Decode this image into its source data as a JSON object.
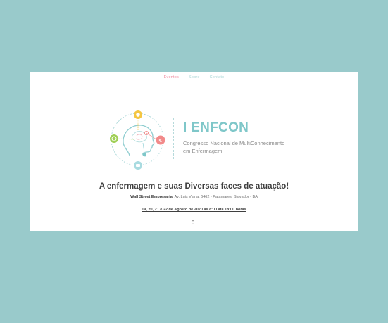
{
  "nav": {
    "items": [
      {
        "label": "Eventos",
        "active": true
      },
      {
        "label": "Sobre",
        "active": false
      },
      {
        "label": "Contato",
        "active": false
      }
    ]
  },
  "brand": {
    "title": "I ENFCON",
    "subtitle_line1": "Congresso Nacional de MultiConhecimento",
    "subtitle_line2": "em Enfermagem"
  },
  "headline": "A enfermagem e suas Diversas faces de atuação!",
  "venue": {
    "name": "Wall Street Empresarial",
    "address": " Av. Luis Viana, 6462 - Patamares, Salvador - BA"
  },
  "dates": "19, 20, 21 e 22 de Agosto de 2020 às 8:00 até 18:00 horas",
  "icons": {
    "logo": "head-brain-logo",
    "scroll": "mouse-scroll-icon"
  },
  "colors": {
    "background": "#99cacb",
    "accent_teal": "#7fc7c9",
    "nav_active": "#f0879a",
    "logo_yellow": "#f4c642",
    "logo_green": "#9fcf55",
    "logo_pink": "#f28a8a",
    "logo_blue": "#8fd0d6"
  }
}
